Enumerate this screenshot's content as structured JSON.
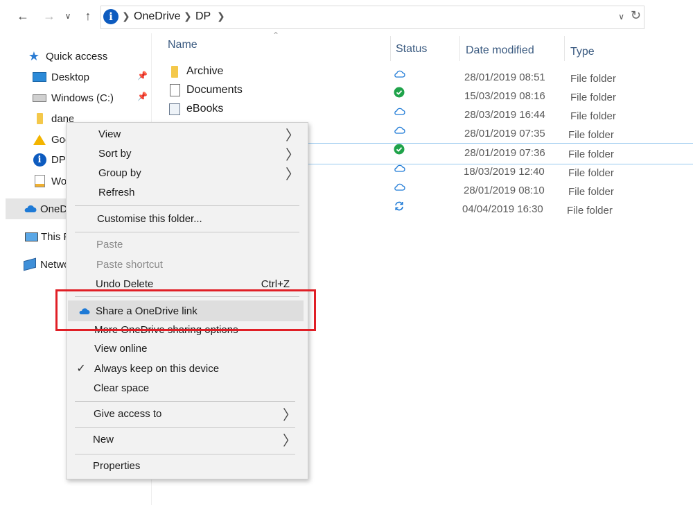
{
  "colors": {
    "accent": "#0d5bbf",
    "highlight_box": "#e01f26",
    "synced_green": "#1fa34a",
    "cloud_blue": "#1e7ad6"
  },
  "address_bar": {
    "crumbs": [
      "OneDrive",
      "DP"
    ]
  },
  "nav_pane": {
    "items": [
      {
        "label": "Quick access",
        "icon": "star-icon"
      },
      {
        "label": "Desktop",
        "icon": "desktop-icon",
        "pinned": true
      },
      {
        "label": "Windows (C:)",
        "icon": "drive-icon",
        "pinned": true
      },
      {
        "label": "danes",
        "icon": "folder-icon",
        "pinned": true
      },
      {
        "label": "Goo",
        "icon": "google-drive-icon"
      },
      {
        "label": "DP",
        "icon": "info-icon"
      },
      {
        "label": "Wor",
        "icon": "word-doc-icon"
      },
      {
        "label": "OneD",
        "icon": "onedrive-cloud-icon"
      },
      {
        "label": "This P",
        "icon": "this-pc-icon"
      },
      {
        "label": "Netwo",
        "icon": "network-icon"
      }
    ]
  },
  "file_list": {
    "columns": {
      "name": "Name",
      "status": "Status",
      "date": "Date modified",
      "type": "Type"
    },
    "rows": [
      {
        "name": "Archive",
        "icon": "folder-icon",
        "status": "cloud",
        "date": "28/01/2019 08:51",
        "type": "File folder"
      },
      {
        "name": "Documents",
        "icon": "documents-icon",
        "status": "synced",
        "date": "15/03/2019 08:16",
        "type": "File folder"
      },
      {
        "name": "eBooks",
        "icon": "ebooks-icon",
        "status": "cloud",
        "date": "28/03/2019 16:44",
        "type": "File folder"
      },
      {
        "name": "",
        "icon": "",
        "status": "cloud",
        "date": "28/01/2019 07:35",
        "type": "File folder"
      },
      {
        "name": "",
        "icon": "",
        "status": "synced",
        "date": "28/01/2019 07:36",
        "type": "File folder"
      },
      {
        "name": "",
        "icon": "",
        "status": "cloud",
        "date": "18/03/2019 12:40",
        "type": "File folder"
      },
      {
        "name": "",
        "icon": "",
        "status": "cloud",
        "date": "28/01/2019 08:10",
        "type": "File folder"
      },
      {
        "name": "",
        "icon": "",
        "status": "syncing",
        "date": "04/04/2019 16:30",
        "type": "File folder"
      }
    ]
  },
  "context_menu": {
    "view": "View",
    "sort_by": "Sort by",
    "group_by": "Group by",
    "refresh": "Refresh",
    "customise": "Customise this folder...",
    "paste": "Paste",
    "paste_shortcut": "Paste shortcut",
    "undo_delete": "Undo Delete",
    "undo_shortcut": "Ctrl+Z",
    "share_onedrive": "Share a OneDrive link",
    "more_sharing": "More OneDrive sharing options",
    "view_online": "View online",
    "always_keep": "Always keep on this device",
    "clear_space": "Clear space",
    "give_access": "Give access to",
    "new": "New",
    "properties": "Properties"
  }
}
